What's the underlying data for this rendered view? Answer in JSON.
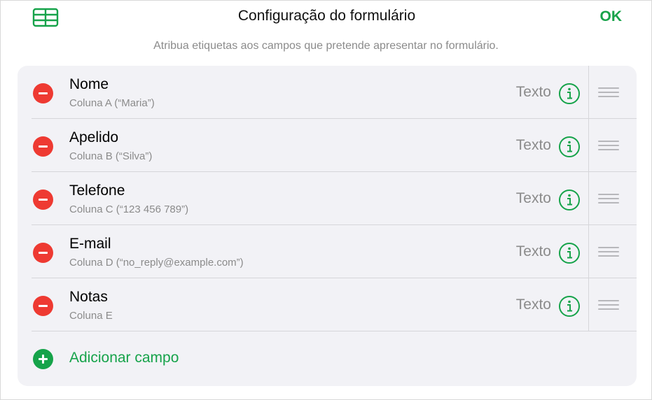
{
  "header": {
    "title": "Configuração do formulário",
    "ok_label": "OK",
    "subtitle": "Atribua etiquetas aos campos que pretende apresentar no formulário.",
    "table_icon": "table-icon"
  },
  "fields": [
    {
      "name": "Nome",
      "source": "Coluna A (“Maria”)",
      "type": "Texto"
    },
    {
      "name": "Apelido",
      "source": "Coluna B (“Silva”)",
      "type": "Texto"
    },
    {
      "name": "Telefone",
      "source": "Coluna C (“123 456 789”)",
      "type": "Texto"
    },
    {
      "name": "E-mail",
      "source": "Coluna D (“no_reply@example.com”)",
      "type": "Texto"
    },
    {
      "name": "Notas",
      "source": "Coluna E",
      "type": "Texto"
    }
  ],
  "add_field": {
    "label": "Adicionar campo"
  },
  "colors": {
    "accent_green": "#16a34a",
    "delete_red": "#ee3a32",
    "secondary_text": "#8b8b8b",
    "card_bg": "#f2f2f6"
  }
}
